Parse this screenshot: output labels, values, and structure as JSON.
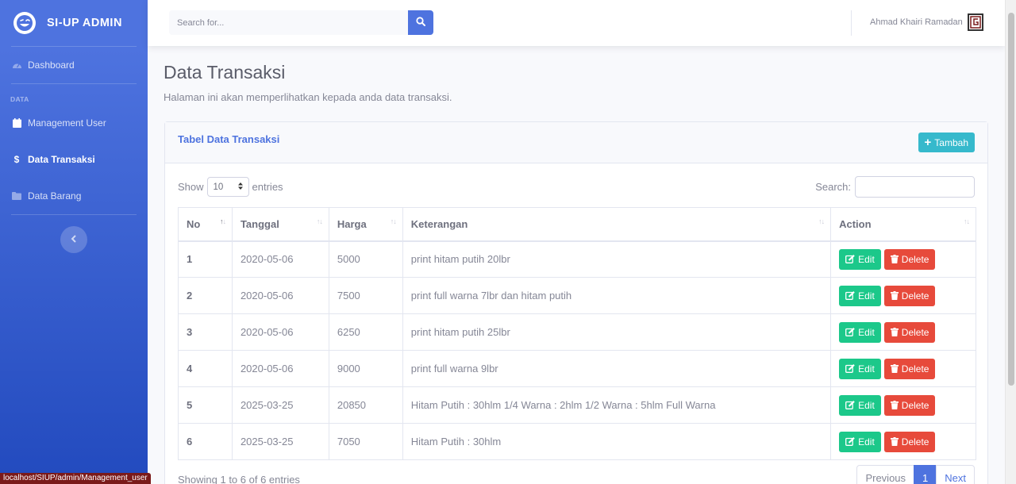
{
  "sidebar": {
    "brand": "SI-UP ADMIN",
    "dashboard": "Dashboard",
    "heading": "DATA",
    "items": [
      {
        "label": "Management User"
      },
      {
        "label": "Data Transaksi"
      },
      {
        "label": "Data Barang"
      }
    ]
  },
  "topbar": {
    "search_placeholder": "Search for...",
    "user_name": "Ahmad Khairi Ramadan"
  },
  "page": {
    "title": "Data Transaksi",
    "description": "Halaman ini akan memperlihatkan kepada anda data transaksi."
  },
  "card": {
    "title": "Tabel Data Transaksi",
    "add_button": "Tambah",
    "show_label": "Show",
    "entries_value": "10",
    "entries_label": "entries",
    "search_label": "Search:"
  },
  "table": {
    "headers": [
      "No",
      "Tanggal",
      "Harga",
      "Keterangan",
      "Action"
    ],
    "rows": [
      {
        "no": "1",
        "tanggal": "2020-05-06",
        "harga": "5000",
        "keterangan": "print hitam putih 20lbr"
      },
      {
        "no": "2",
        "tanggal": "2020-05-06",
        "harga": "7500",
        "keterangan": "print full warna 7lbr dan hitam putih"
      },
      {
        "no": "3",
        "tanggal": "2020-05-06",
        "harga": "6250",
        "keterangan": "print hitam putih 25lbr"
      },
      {
        "no": "4",
        "tanggal": "2020-05-06",
        "harga": "9000",
        "keterangan": "print full warna 9lbr"
      },
      {
        "no": "5",
        "tanggal": "2025-03-25",
        "harga": "20850",
        "keterangan": "Hitam Putih : 30hlm 1/4 Warna : 2hlm 1/2 Warna : 5hlm Full Warna"
      },
      {
        "no": "6",
        "tanggal": "2025-03-25",
        "harga": "7050",
        "keterangan": "Hitam Putih : 30hlm"
      }
    ],
    "edit_label": "Edit",
    "delete_label": "Delete"
  },
  "footer": {
    "info": "Showing 1 to 6 of 6 entries",
    "previous": "Previous",
    "page": "1",
    "next": "Next"
  },
  "status_url": "localhost/SIUP/admin/Management_user",
  "colors": {
    "primary": "#4e73df",
    "success": "#1cc88a",
    "danger": "#e74a3b",
    "info": "#36b9cc"
  }
}
